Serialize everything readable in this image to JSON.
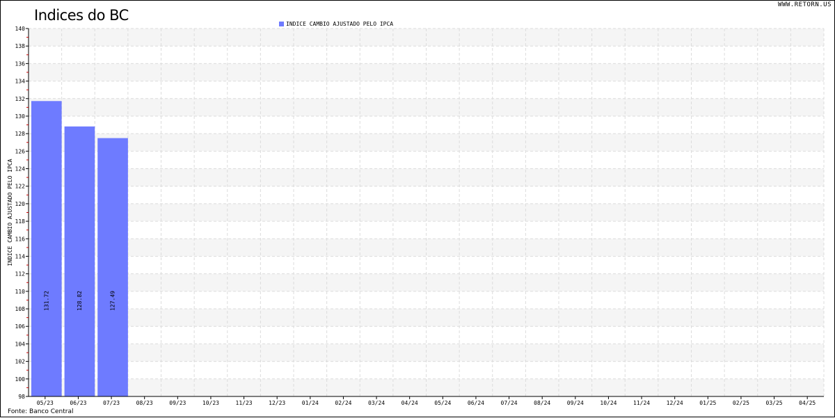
{
  "site_url": "WWW.RETORN.US",
  "source": "Fonte: Banco Central",
  "colors": {
    "bar": "#6e7bff",
    "grid_band": "#f5f5f5",
    "grid_line": "#dcdcdc",
    "tick_red": "#cc0000"
  },
  "chart_data": {
    "type": "bar",
    "title": "Indices do BC",
    "ylabel": "INDICE CAMBIO AJUSTADO PELO IPCA",
    "xlabel": "",
    "ylim": [
      98,
      140
    ],
    "y_ticks": [
      98,
      100,
      102,
      104,
      106,
      108,
      110,
      112,
      114,
      116,
      118,
      120,
      122,
      124,
      126,
      128,
      130,
      132,
      134,
      136,
      138,
      140
    ],
    "grid": true,
    "legend_position": "top-center",
    "categories": [
      "05/23",
      "06/23",
      "07/23",
      "08/23",
      "09/23",
      "10/23",
      "11/23",
      "12/23",
      "01/24",
      "02/24",
      "03/24",
      "04/24",
      "05/24",
      "06/24",
      "07/24",
      "08/24",
      "09/24",
      "10/24",
      "11/24",
      "12/24",
      "01/25",
      "02/25",
      "03/25",
      "04/25"
    ],
    "series": [
      {
        "name": "INDICE CAMBIO AJUSTADO PELO IPCA",
        "values": [
          131.72,
          128.82,
          127.49,
          null,
          null,
          null,
          null,
          null,
          null,
          null,
          null,
          null,
          null,
          null,
          null,
          null,
          null,
          null,
          null,
          null,
          null,
          null,
          null,
          null
        ],
        "data_labels": [
          "131.72",
          "128.82",
          "127.49"
        ]
      }
    ]
  }
}
